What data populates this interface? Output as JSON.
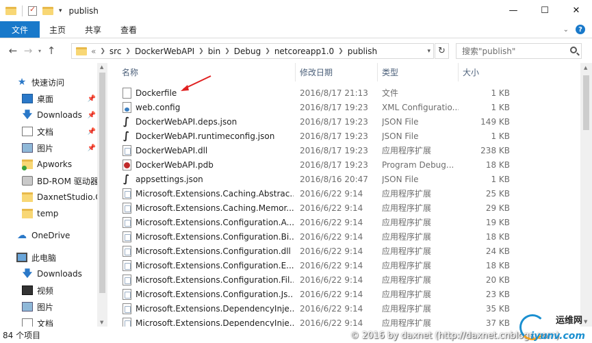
{
  "titlebar": {
    "title": "publish",
    "buttons": [
      "minimize",
      "maximize",
      "close"
    ]
  },
  "ribbon": {
    "tabs": [
      "文件",
      "主页",
      "共享",
      "查看"
    ]
  },
  "address": {
    "overflow": "«",
    "crumbs": [
      "src",
      "DockerWebAPI",
      "bin",
      "Debug",
      "netcoreapp1.0",
      "publish"
    ],
    "search_placeholder": "搜索\"publish\""
  },
  "navpane": {
    "items": [
      {
        "label": "快速访问",
        "icon": "star-icon",
        "pinned": false
      },
      {
        "label": "桌面",
        "icon": "desktop-icon",
        "pinned": true
      },
      {
        "label": "Downloads",
        "icon": "download-icon",
        "pinned": true
      },
      {
        "label": "文档",
        "icon": "document-icon",
        "pinned": true
      },
      {
        "label": "图片",
        "icon": "picture-icon",
        "pinned": true
      },
      {
        "label": "Apworks",
        "icon": "folder-sync-icon",
        "pinned": false
      },
      {
        "label": "BD-ROM 驱动器",
        "icon": "disc-drive-icon",
        "pinned": false
      },
      {
        "label": "DaxnetStudio.Co",
        "icon": "folder-icon",
        "pinned": false
      },
      {
        "label": "temp",
        "icon": "folder-icon",
        "pinned": false
      },
      {
        "label": "OneDrive",
        "icon": "cloud-icon",
        "pinned": false
      },
      {
        "label": "此电脑",
        "icon": "computer-icon",
        "pinned": false
      },
      {
        "label": "Downloads",
        "icon": "download-icon",
        "pinned": false
      },
      {
        "label": "视频",
        "icon": "video-icon",
        "pinned": false
      },
      {
        "label": "图片",
        "icon": "picture-icon",
        "pinned": false
      },
      {
        "label": "文档",
        "icon": "document-icon",
        "pinned": false
      }
    ]
  },
  "list": {
    "columns": {
      "name": "名称",
      "date": "修改日期",
      "type": "类型",
      "size": "大小"
    },
    "files": [
      {
        "name": "Dockerfile",
        "date": "2016/8/17 21:13",
        "type": "文件",
        "size": "1 KB",
        "icon": "file-icon"
      },
      {
        "name": "web.config",
        "date": "2016/8/17 19:23",
        "type": "XML Configuratio...",
        "size": "1 KB",
        "icon": "config-file-icon"
      },
      {
        "name": "DockerWebAPI.deps.json",
        "date": "2016/8/17 19:23",
        "type": "JSON File",
        "size": "149 KB",
        "icon": "json-file-icon"
      },
      {
        "name": "DockerWebAPI.runtimeconfig.json",
        "date": "2016/8/17 19:23",
        "type": "JSON File",
        "size": "1 KB",
        "icon": "json-file-icon"
      },
      {
        "name": "DockerWebAPI.dll",
        "date": "2016/8/17 19:23",
        "type": "应用程序扩展",
        "size": "238 KB",
        "icon": "dll-file-icon"
      },
      {
        "name": "DockerWebAPI.pdb",
        "date": "2016/8/17 19:23",
        "type": "Program Debug...",
        "size": "18 KB",
        "icon": "pdb-file-icon"
      },
      {
        "name": "appsettings.json",
        "date": "2016/8/16 20:47",
        "type": "JSON File",
        "size": "1 KB",
        "icon": "json-file-icon"
      },
      {
        "name": "Microsoft.Extensions.Caching.Abstrac...",
        "date": "2016/6/22 9:14",
        "type": "应用程序扩展",
        "size": "25 KB",
        "icon": "dll-file-icon"
      },
      {
        "name": "Microsoft.Extensions.Caching.Memor...",
        "date": "2016/6/22 9:14",
        "type": "应用程序扩展",
        "size": "29 KB",
        "icon": "dll-file-icon"
      },
      {
        "name": "Microsoft.Extensions.Configuration.A...",
        "date": "2016/6/22 9:14",
        "type": "应用程序扩展",
        "size": "19 KB",
        "icon": "dll-file-icon"
      },
      {
        "name": "Microsoft.Extensions.Configuration.Bi...",
        "date": "2016/6/22 9:14",
        "type": "应用程序扩展",
        "size": "18 KB",
        "icon": "dll-file-icon"
      },
      {
        "name": "Microsoft.Extensions.Configuration.dll",
        "date": "2016/6/22 9:14",
        "type": "应用程序扩展",
        "size": "24 KB",
        "icon": "dll-file-icon"
      },
      {
        "name": "Microsoft.Extensions.Configuration.E...",
        "date": "2016/6/22 9:14",
        "type": "应用程序扩展",
        "size": "18 KB",
        "icon": "dll-file-icon"
      },
      {
        "name": "Microsoft.Extensions.Configuration.Fil...",
        "date": "2016/6/22 9:14",
        "type": "应用程序扩展",
        "size": "20 KB",
        "icon": "dll-file-icon"
      },
      {
        "name": "Microsoft.Extensions.Configuration.Js...",
        "date": "2016/6/22 9:14",
        "type": "应用程序扩展",
        "size": "23 KB",
        "icon": "dll-file-icon"
      },
      {
        "name": "Microsoft.Extensions.DependencyInje...",
        "date": "2016/6/22 9:14",
        "type": "应用程序扩展",
        "size": "35 KB",
        "icon": "dll-file-icon"
      },
      {
        "name": "Microsoft.Extensions.DependencyInje...",
        "date": "2016/6/22 9:14",
        "type": "应用程序扩展",
        "size": "37 KB",
        "icon": "dll-file-icon"
      }
    ]
  },
  "status": {
    "count": "84 个项目"
  },
  "watermark": {
    "text": "© 2016 by daxnet (http://daxnet.cnblogs.com)",
    "logo_top": "运维网",
    "logo_bottom": "iyunv.com"
  },
  "colors": {
    "accent": "#1979ca",
    "arrow": "#e02020"
  }
}
